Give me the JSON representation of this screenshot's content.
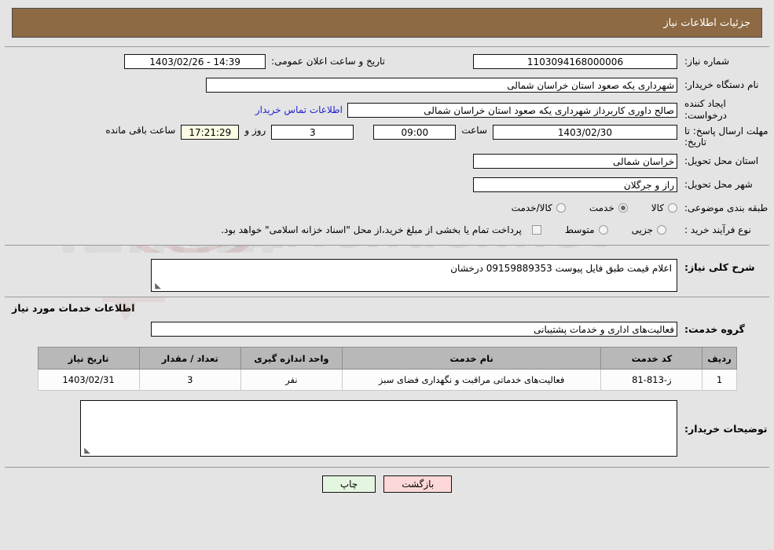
{
  "header": {
    "title": "جزئیات اطلاعات نیاز"
  },
  "form": {
    "need_number_label": "شماره نیاز:",
    "need_number_value": "1103094168000006",
    "public_announce_label": "تاریخ و ساعت اعلان عمومی:",
    "public_announce_value": "14:39 - 1403/02/26",
    "buyer_org_label": "نام دستگاه خریدار:",
    "buyer_org_value": "شهرداری یکه صعود استان خراسان شمالی",
    "requester_label": "ایجاد کننده درخواست:",
    "requester_value": "صالح داوری کاربرداز شهرداری یکه صعود استان خراسان شمالی",
    "contact_link": "اطلاعات تماس خریدار",
    "deadline_label": "مهلت ارسال پاسخ: تا تاریخ:",
    "deadline_date": "1403/02/30",
    "hour_label": "ساعت",
    "deadline_time": "09:00",
    "days_value": "3",
    "days_label": "روز و",
    "countdown_value": "17:21:29",
    "remaining_label": "ساعت باقی مانده",
    "province_label": "استان محل تحویل:",
    "province_value": "خراسان شمالی",
    "city_label": "شهر محل تحویل:",
    "city_value": "راز و جرگلان",
    "category_label": "طبقه بندی موضوعی:",
    "category_options": [
      {
        "label": "کالا",
        "selected": false
      },
      {
        "label": "خدمت",
        "selected": true
      },
      {
        "label": "کالا/خدمت",
        "selected": false
      }
    ],
    "process_label": "نوع فرآیند خرید :",
    "process_options": [
      {
        "label": "جزیی",
        "selected": false
      },
      {
        "label": "متوسط",
        "selected": false
      }
    ],
    "treasury_note": "پرداخت تمام یا بخشی از مبلغ خرید،از محل \"اسناد خزانه اسلامی\" خواهد بود."
  },
  "description": {
    "label": "شرح کلی نیاز:",
    "value": "اعلام قیمت طبق فایل پیوست 09159889353 درخشان"
  },
  "services_section": {
    "heading": "اطلاعات خدمات مورد نیاز",
    "group_label": "گروه خدمت:",
    "group_value": "فعالیت‌های اداری و خدمات پشتیبانی"
  },
  "table": {
    "columns": [
      "ردیف",
      "کد خدمت",
      "نام خدمت",
      "واحد اندازه گیری",
      "تعداد / مقدار",
      "تاریخ نیاز"
    ],
    "rows": [
      {
        "index": "1",
        "code": "ز-813-81",
        "name": "فعالیت‌های خدماتی مراقبت و نگهداری فضای سبز",
        "unit": "نفر",
        "quantity": "3",
        "date": "1403/02/31"
      }
    ]
  },
  "buyer_notes": {
    "label": "توضیحات خریدار:",
    "value": ""
  },
  "buttons": {
    "print": "چاپ",
    "back": "بازگشت"
  },
  "colors": {
    "header_bg": "#8d6a43",
    "page_bg": "#e4e4e4",
    "link": "#2222cc",
    "timer_bg": "#fbfbe4",
    "btn_back_bg": "#fdd8d8",
    "btn_print_bg": "#e4f5e0",
    "table_header_bg": "#b8b8b8"
  }
}
